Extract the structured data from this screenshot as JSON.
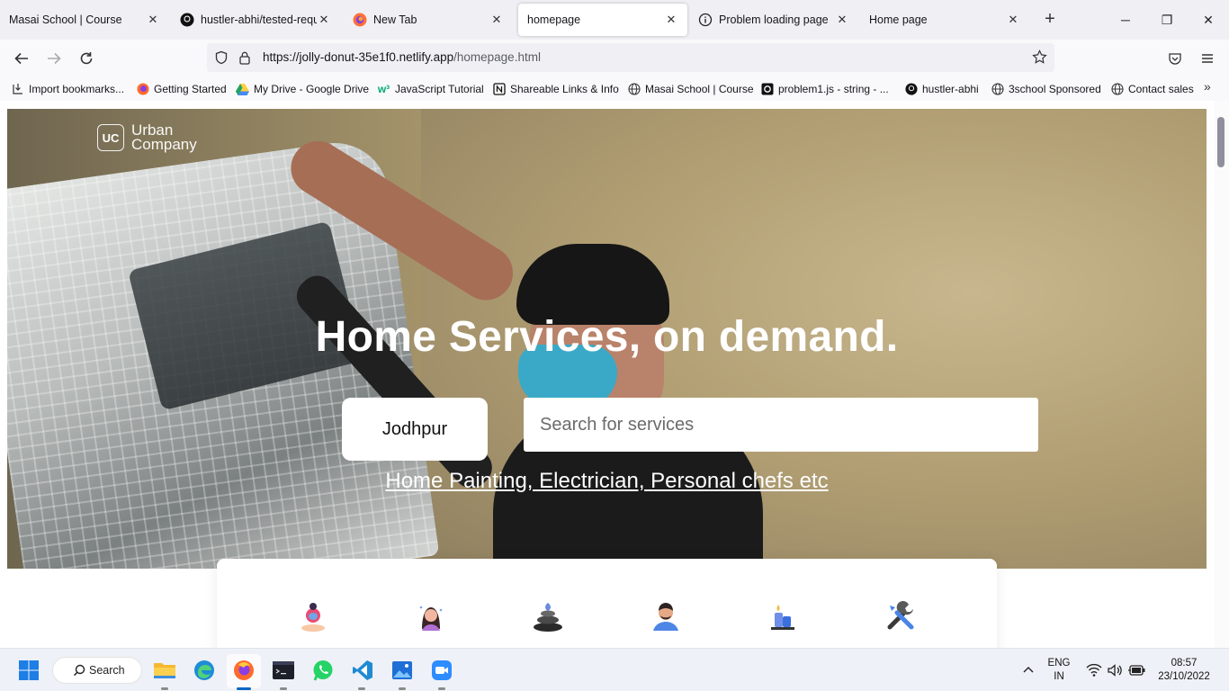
{
  "browser": {
    "tabs": [
      {
        "title": "Masai School | Course",
        "icon": "masai-icon",
        "active": false
      },
      {
        "title": "hustler-abhi/tested-reque",
        "icon": "github-icon",
        "active": false
      },
      {
        "title": "New Tab",
        "icon": "firefox-icon",
        "active": false
      },
      {
        "title": "homepage",
        "icon": "",
        "active": true
      },
      {
        "title": "Problem loading page",
        "icon": "info-icon",
        "active": false
      },
      {
        "title": "Home page",
        "icon": "",
        "active": false
      }
    ],
    "url_host": "https://jolly-donut-35e1f0.netlify.app",
    "url_path": "/homepage.html",
    "bookmarks": [
      {
        "label": "Import bookmarks...",
        "icon": "import-icon"
      },
      {
        "label": "Getting Started",
        "icon": "firefox-icon"
      },
      {
        "label": "My Drive - Google Drive",
        "icon": "google-drive-icon"
      },
      {
        "label": "JavaScript Tutorial",
        "icon": "w3schools-icon"
      },
      {
        "label": "Shareable Links & Info",
        "icon": "notion-icon"
      },
      {
        "label": "Masai School | Course",
        "icon": "globe-icon"
      },
      {
        "label": "problem1.js - string - ...",
        "icon": "code-icon"
      },
      {
        "label": "hustler-abhi",
        "icon": "github-icon"
      },
      {
        "label": "3school Sponsored",
        "icon": "globe-icon"
      },
      {
        "label": "Contact sales",
        "icon": "globe-icon"
      }
    ]
  },
  "page": {
    "logo_badge": "UC",
    "logo_line1": "Urban",
    "logo_line2": "Company",
    "hero_title": "Home Services, on demand.",
    "city": "Jodhpur",
    "search_placeholder": "Search for services",
    "hero_link": "Home Painting, Electrician, Personal chefs etc",
    "services": [
      {
        "icon": "salon-women-icon"
      },
      {
        "icon": "hair-care-icon"
      },
      {
        "icon": "spa-stones-icon"
      },
      {
        "icon": "salon-men-icon"
      },
      {
        "icon": "cleaning-icon"
      },
      {
        "icon": "repair-tools-icon"
      }
    ]
  },
  "taskbar": {
    "search_label": "Search",
    "lang_line1": "ENG",
    "lang_line2": "IN",
    "time": "08:57",
    "date": "23/10/2022"
  }
}
